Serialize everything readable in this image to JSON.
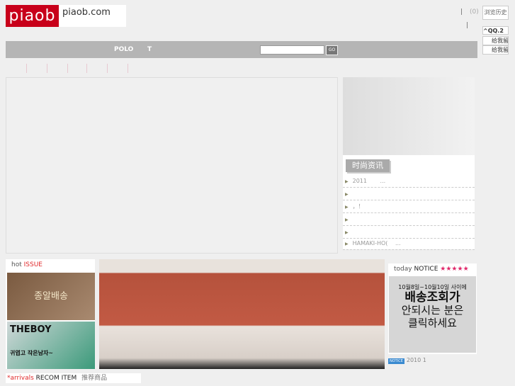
{
  "logo": {
    "mark": "piaob",
    "site": "piaob.com"
  },
  "header": {
    "cart_count": "(0)",
    "pipe": "|",
    "history": "浏览历史"
  },
  "nav": {
    "items": [
      "POLO",
      "T"
    ],
    "search_placeholder": "",
    "go": "GO"
  },
  "news": {
    "title": "时尚资讯",
    "items": [
      "2011　　 ...",
      "",
      "，！",
      "",
      "",
      "HAMAKI-HO(　 ..."
    ]
  },
  "hot": {
    "prefix": "hot",
    "title": "ISSUE",
    "banner1": "종알배송",
    "banner2": "THEBOY",
    "banner2_sub": "귀엽고 작은남자~"
  },
  "notice": {
    "prefix": "today",
    "title": "NOTICE",
    "stars": "★★★★★",
    "line1": "10월8일~10월10일 사이에",
    "line2": "배송조회가",
    "line3": "안되시는 분은",
    "line4": "클릭하세요",
    "badge": "NOTICE",
    "latest": "2010 1"
  },
  "arrivals": {
    "prefix": "*arrivals",
    "title": "RECOM ITEM",
    "cn": "推荐商品"
  },
  "side": {
    "qq": "^QQ.2",
    "msg1": "给我留言",
    "msg2": "给我留言"
  },
  "colors": {
    "brand": "#c8001a",
    "bar": "#b5b5b5"
  }
}
